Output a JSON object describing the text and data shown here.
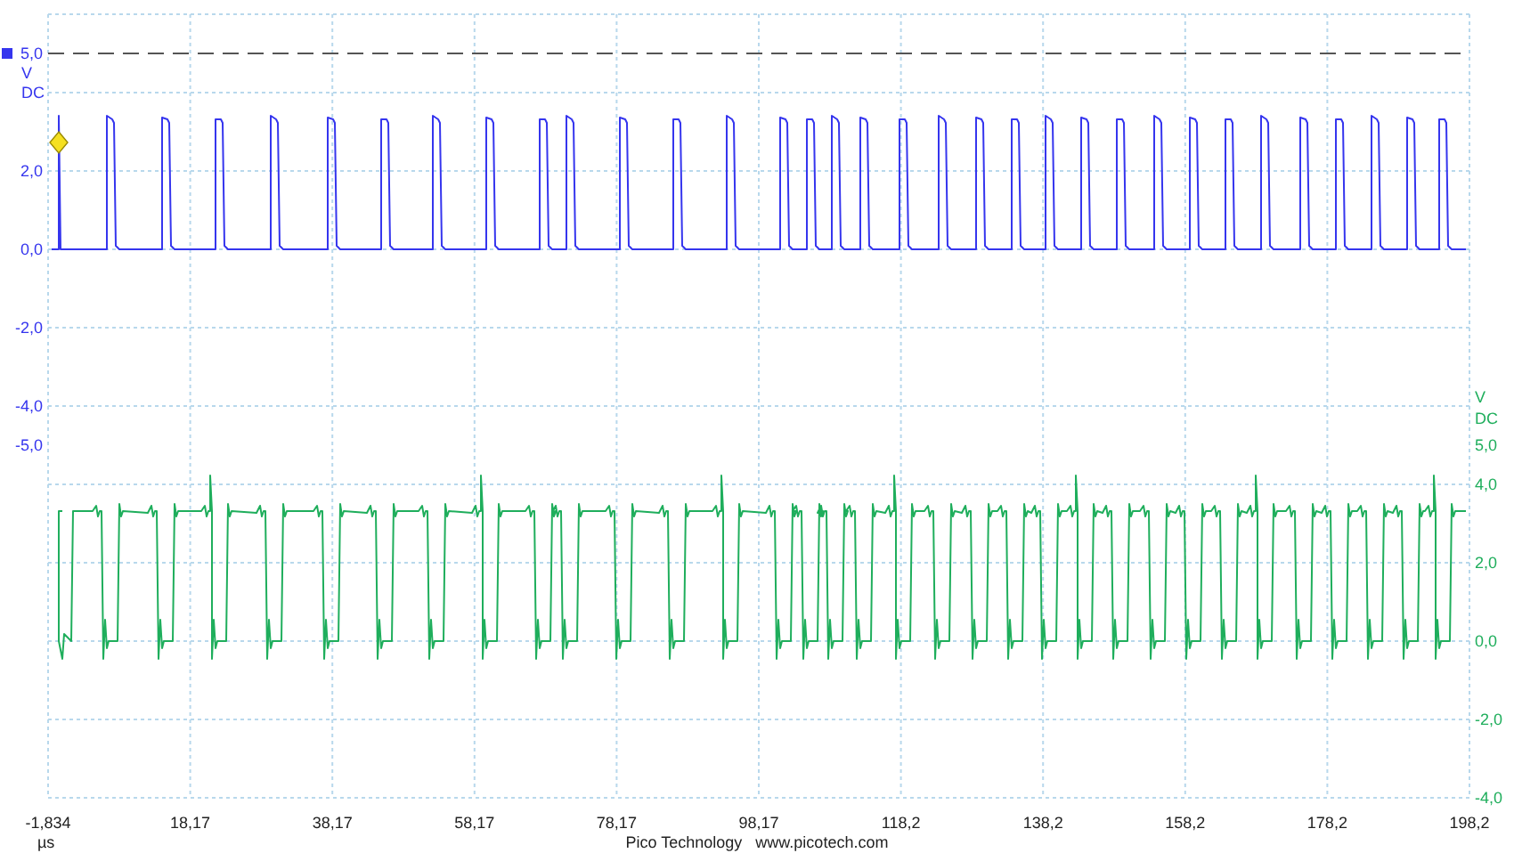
{
  "channels": [
    {
      "color": "#3535ee",
      "unit": "V",
      "coupling": "DC",
      "ticks": [
        "5,0",
        "2,0",
        "0,0",
        "-2,0",
        "-4,0",
        "-5,0"
      ]
    },
    {
      "color": "#1fae5c",
      "unit": "V",
      "coupling": "DC",
      "ticks": [
        "5,0",
        "4,0",
        "2,0",
        "0,0",
        "-2,0",
        "-4,0"
      ]
    }
  ],
  "time_axis": {
    "ticks": [
      "-1,834",
      "18,17",
      "38,17",
      "58,17",
      "78,17",
      "98,17",
      "118,2",
      "138,2",
      "158,2",
      "178,2",
      "198,2"
    ],
    "unit": "µs"
  },
  "footer": "Pico Technology   www.picotech.com"
}
